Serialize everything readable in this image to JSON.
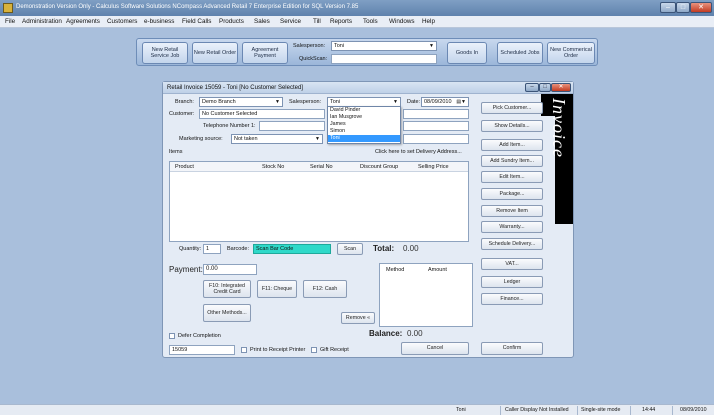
{
  "app": {
    "title": "Demonstration Version Only - Calculus Software Solutions NCompass Advanced Retail 7 Enterprise Edition for SQL Version 7.85"
  },
  "menu": [
    "File",
    "Administration",
    "Agreements",
    "Customers",
    "e-business",
    "Field Calls",
    "Products",
    "Sales",
    "Service",
    "Till",
    "Reports",
    "Tools",
    "Windows",
    "Help"
  ],
  "toolbar": {
    "new_retail_service_job": "New Retail Service Job",
    "new_retail_order": "New Retail Order",
    "agreement_payment": "Agreement Payment",
    "salesperson_label": "Salesperson:",
    "salesperson_value": "Toni",
    "quickscan_label": "QuickScan:",
    "quickscan_value": "",
    "goods_in": "Goods In",
    "scheduled_jobs": "Scheduled Jobs",
    "new_commercial_order": "New Commerical Order"
  },
  "invoice": {
    "title": "Retail Invoice 15059 - Toni [No Customer Selected]",
    "branch_label": "Branch:",
    "branch_value": "Demo Branch",
    "salesperson_label": "Salesperson:",
    "salesperson_value": "Toni",
    "date_label": "Date:",
    "date_value": "08/09/2010",
    "customer_label": "Customer:",
    "customer_value": "No Customer Selected",
    "telephone_label": "Telephone Number 1:",
    "telephone_value": "",
    "marketing_label": "Marketing source:",
    "marketing_value": "Not taken",
    "items_label": "Items",
    "delivery_link": "Click here to set Delivery Address...",
    "columns": [
      "Product",
      "Stock No",
      "Serial No",
      "Discount Group",
      "Selling Price"
    ],
    "quantity_label": "Quantity:",
    "quantity_value": "1",
    "barcode_label": "Barcode:",
    "barcode_value": "Scan Bar Code",
    "scan_button": "Scan",
    "total_label": "Total:",
    "total_value": "0.00",
    "payment_label": "Payment:",
    "payment_value": "0.00",
    "f10_button": "F10: Integrated Credit Card",
    "f11_button": "F11: Cheque",
    "f12_button": "F12: Cash",
    "other_methods": "Other Methods...",
    "remove_button": "Remove «",
    "pay_columns": [
      "Method",
      "Amount"
    ],
    "balance_label": "Balance:",
    "balance_value": "0.00",
    "defer_label": "Defer Completion",
    "invoice_no": "15059",
    "print_receipt_label": "Print to Receipt Printer",
    "gift_receipt_label": "Gift Receipt",
    "cancel_button": "Cancel",
    "confirm_button": "Confirm",
    "banner_text": "Invoice",
    "salesperson_options": [
      "David Pinder",
      "Ian Musgrove",
      "James",
      "Simon",
      "Toni"
    ],
    "salesperson_selected_index": 4
  },
  "side_buttons": [
    "Pick Customer...",
    "Show Details...",
    "Add Item...",
    "Add Sundry Item...",
    "Edit Item...",
    "Package...",
    "Remove Item",
    "Warranty...",
    "Schedule Delivery...",
    "VAT...",
    "Ledger",
    "Finance..."
  ],
  "status": {
    "user": "Toni",
    "caller_display": "Caller Display Not Installed",
    "mode": "Single-site mode",
    "time": "14:44",
    "date": "08/09/2010"
  },
  "colors": {
    "barcode_bg": "#2fd9c9",
    "selected_option": "#3399ff"
  }
}
